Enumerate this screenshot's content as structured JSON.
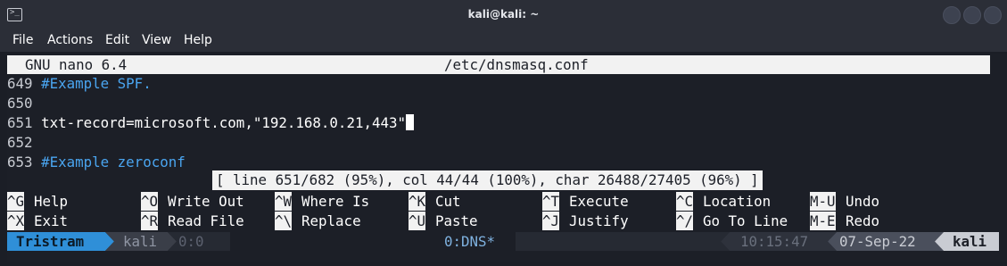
{
  "window": {
    "title": "kali@kali: ~"
  },
  "menu": [
    "File",
    "Actions",
    "Edit",
    "View",
    "Help"
  ],
  "nano": {
    "version": "GNU nano 6.4",
    "filename": "/etc/dnsmasq.conf",
    "lines": [
      {
        "num": "649",
        "text": "#Example SPF.",
        "comment": true
      },
      {
        "num": "650",
        "text": "",
        "comment": false
      },
      {
        "num": "651",
        "text": "txt-record=microsoft.com,\"192.168.0.21,443\"",
        "comment": false
      },
      {
        "num": "652",
        "text": "",
        "comment": false
      },
      {
        "num": "653",
        "text": "#Example zeroconf",
        "comment": true
      }
    ],
    "status": "[ line 651/682 (95%), col 44/44 (100%), char 26488/27405 (96%) ]",
    "shortcuts": [
      {
        "key": "^G",
        "label": "Help"
      },
      {
        "key": "^O",
        "label": "Write Out"
      },
      {
        "key": "^W",
        "label": "Where Is"
      },
      {
        "key": "^K",
        "label": "Cut"
      },
      {
        "key": "^T",
        "label": "Execute"
      },
      {
        "key": "^C",
        "label": "Location"
      },
      {
        "key": "M-U",
        "label": "Undo"
      },
      {
        "key": "^X",
        "label": "Exit"
      },
      {
        "key": "^R",
        "label": "Read File"
      },
      {
        "key": "^\\",
        "label": "Replace"
      },
      {
        "key": "^U",
        "label": "Paste"
      },
      {
        "key": "^J",
        "label": "Justify"
      },
      {
        "key": "^/",
        "label": "Go To Line"
      },
      {
        "key": "M-E",
        "label": "Redo"
      }
    ]
  },
  "tmux": {
    "session": "Tristram",
    "host": "kali",
    "pane": "0:0",
    "window": "0:DNS*",
    "time": "10:15:47",
    "date": "07-Sep-22",
    "hostname": "kali"
  },
  "colors": {
    "accent": "#4aa5f0",
    "session_bg": "#2f8fd8"
  }
}
